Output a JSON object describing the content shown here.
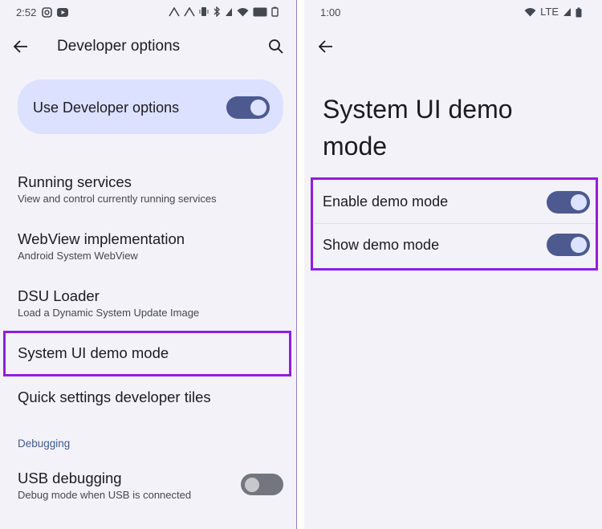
{
  "left": {
    "status": {
      "time": "2:52"
    },
    "title": "Developer options",
    "master_switch": {
      "label": "Use Developer options",
      "on": true
    },
    "items": [
      {
        "title": "Running services",
        "summary": "View and control currently running services"
      },
      {
        "title": "WebView implementation",
        "summary": "Android System WebView"
      },
      {
        "title": "DSU Loader",
        "summary": "Load a Dynamic System Update Image"
      },
      {
        "title": "System UI demo mode"
      },
      {
        "title": "Quick settings developer tiles"
      }
    ],
    "category": "Debugging",
    "usb_debugging": {
      "title": "USB debugging",
      "summary": "Debug mode when USB is connected",
      "on": false
    }
  },
  "right": {
    "status": {
      "time": "1:00",
      "network": "LTE"
    },
    "title": "System UI demo mode",
    "switches": [
      {
        "label": "Enable demo mode",
        "on": true
      },
      {
        "label": "Show demo mode",
        "on": true
      }
    ]
  },
  "icons": [
    "back-arrow-icon",
    "search-icon",
    "instagram-icon",
    "youtube-icon",
    "wifi-icon",
    "signal-icon",
    "battery-icon",
    "bluetooth-icon",
    "vibrate-icon"
  ],
  "colors": {
    "panel_bg": "#f4f2f9",
    "card_bg": "#dbe1ff",
    "switch_on": "#4c5a8f",
    "highlight": "#8f1ee1",
    "category": "#3d5a8e"
  }
}
